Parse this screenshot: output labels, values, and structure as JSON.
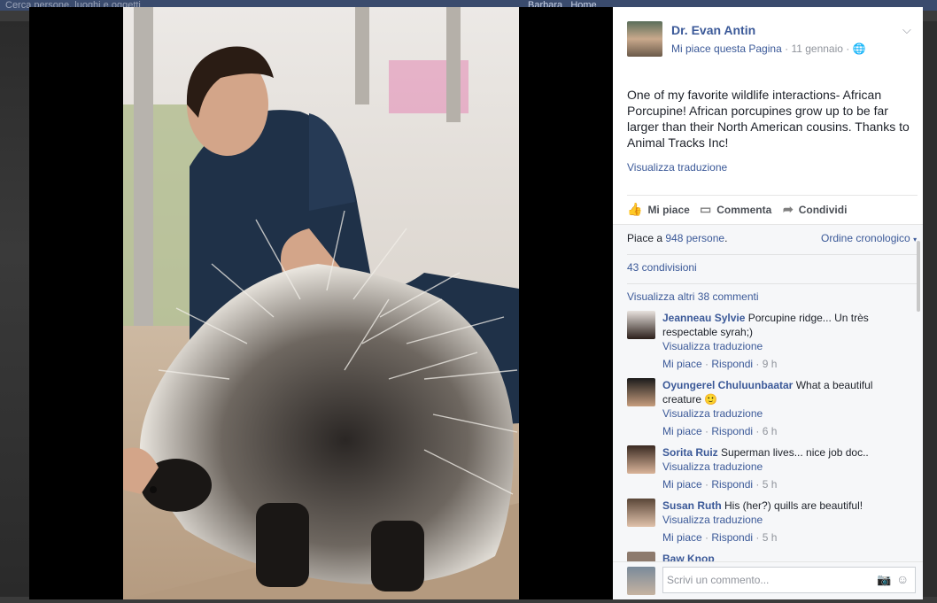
{
  "background": {
    "search_placeholder": "Cerca persone, luoghi e oggetti",
    "nav_user": "Barbara",
    "nav_home": "Home"
  },
  "photo": {
    "alt": "Photo of man kneeling next to an African porcupine"
  },
  "post": {
    "author": "Dr. Evan Antin",
    "like_page": "Mi piace questa Pagina",
    "date": "11 gennaio",
    "text": "One of my favorite wildlife interactions- African Porcupine! African porcupines grow up to be far larger than their North American cousins. Thanks to Animal Tracks Inc!",
    "translate": "Visualizza traduzione",
    "actions": {
      "like": "Mi piace",
      "comment": "Commenta",
      "share": "Condividi"
    }
  },
  "stats": {
    "likes_prefix": "Piace a ",
    "likes_count": "948 persone",
    "likes_suffix": ".",
    "order": "Ordine cronologico",
    "shares": "43 condivisioni",
    "more_comments": "Visualizza altri 38 commenti"
  },
  "comments": [
    {
      "name": "Jeanneau Sylvie",
      "text": "Porcupine ridge... Un très respectable syrah;)",
      "translate": "Visualizza traduzione",
      "like": "Mi piace",
      "reply": "Rispondi",
      "time": "9 h"
    },
    {
      "name": "Oyungerel Chuluunbaatar",
      "text": "What a beautiful creature 🙂",
      "translate": "Visualizza traduzione",
      "like": "Mi piace",
      "reply": "Rispondi",
      "time": "6 h"
    },
    {
      "name": "Sorita Ruiz",
      "text": "Superman lives... nice job doc..",
      "translate": "Visualizza traduzione",
      "like": "Mi piace",
      "reply": "Rispondi",
      "time": "5 h"
    },
    {
      "name": "Susan Ruth",
      "text": "His (her?) quills are beautiful!",
      "translate": "Visualizza traduzione",
      "like": "Mi piace",
      "reply": "Rispondi",
      "time": "5 h"
    },
    {
      "name": "Baw Knop"
    }
  ],
  "composer": {
    "placeholder": "Scrivi un commento..."
  },
  "icons": {
    "like": "thumbs-up-icon",
    "comment": "speech-bubble-icon",
    "share": "share-arrow-icon",
    "privacy": "globe-icon",
    "options": "chevron-down-icon",
    "camera": "camera-icon",
    "emoji": "smiley-icon"
  },
  "colors": {
    "link": "#3b5998",
    "meta": "#90949c",
    "text": "#1d2129"
  }
}
